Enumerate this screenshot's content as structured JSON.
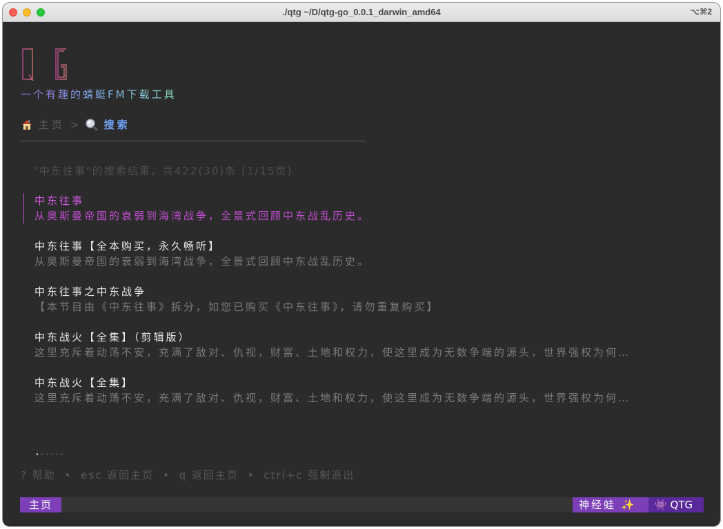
{
  "window": {
    "title": "./qtg  ~/D/qtg-go_0.0.1_darwin_amd64",
    "shortcut": "⌥⌘2"
  },
  "app": {
    "logo_text": "QTG",
    "slogan": "一个有趣的蜻蜓FM下载工具"
  },
  "breadcrumb": {
    "home_label": "主页",
    "separator": ">",
    "current_label": "搜索"
  },
  "search": {
    "summary": "\"中东往事\"的搜索结果，共422(30)条  (1/15页)"
  },
  "results": [
    {
      "title": "中东往事",
      "desc": "从奥斯曼帝国的衰弱到海湾战争，全景式回顾中东战乱历史。",
      "selected": true
    },
    {
      "title": "中东往事【全本购买，永久畅听】",
      "desc": "从奥斯曼帝国的衰弱到海湾战争，全景式回顾中东战乱历史。",
      "selected": false
    },
    {
      "title": "中东往事之中东战争",
      "desc": "【本节目由《中东往事》拆分，如您已购买《中东往事》，请勿重复购买】",
      "selected": false
    },
    {
      "title": "中东战火【全集】（剪辑版）",
      "desc": "这里充斥着动荡不安，充满了敌对、仇视，财富、土地和权力，使这里成为无数争端的源头，世界强权为何…",
      "selected": false
    },
    {
      "title": "中东战火【全集】",
      "desc": "这里充斥着动荡不安，充满了敌对、仇视，财富、土地和权力，使这里成为无数争端的源头，世界强权为何…",
      "selected": false
    }
  ],
  "pager": {
    "current": 1,
    "total": 6
  },
  "help": {
    "items": [
      "? 帮助",
      "esc 返回主页",
      "q 返回主页",
      "ctrl+c 强制退出"
    ],
    "separator": "•"
  },
  "statusbar": {
    "left": "主页",
    "right1_text": "神经蛙",
    "right1_icon": "✨",
    "right2_icon": "👾",
    "right2_text": "QTG"
  },
  "colors": {
    "background": "#2b2b2b",
    "accent": "#7c3fb8",
    "selected": "#c04fd0",
    "link": "#6ea0f0"
  }
}
